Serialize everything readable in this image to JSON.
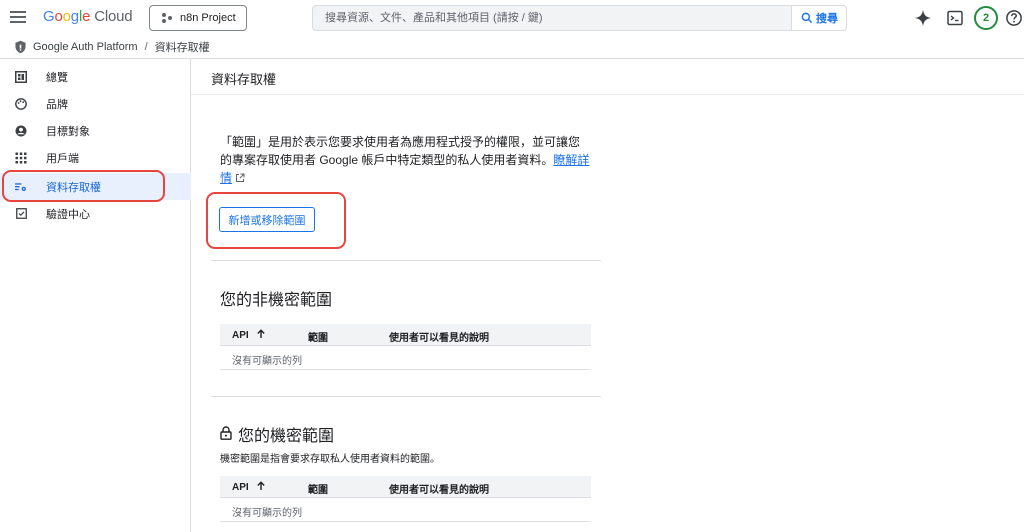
{
  "topbar": {
    "logo_word": "Google",
    "logo_product": "Cloud",
    "project_name": "n8n Project",
    "search_placeholder": "搜尋資源、文件、產品和其他項目 (請按 / 鍵)",
    "search_button": "搜尋",
    "avatar_count": "2"
  },
  "breadcrumb": {
    "root": "Google Auth Platform",
    "separator": "/",
    "current": "資料存取權"
  },
  "sidebar": {
    "items": [
      {
        "label": "總覽",
        "icon": "dashboard-icon"
      },
      {
        "label": "品牌",
        "icon": "palette-icon"
      },
      {
        "label": "目標對象",
        "icon": "account-circle-icon"
      },
      {
        "label": "用戶端",
        "icon": "apps-grid-icon"
      },
      {
        "label": "資料存取權",
        "icon": "data-access-icon",
        "active": true
      },
      {
        "label": "驗證中心",
        "icon": "checkbox-icon"
      }
    ]
  },
  "main": {
    "title": "資料存取權",
    "description": "「範圍」是用於表示您要求使用者為應用程式授予的權限，並可讓您的專案存取使用者 Google 帳戶中特定類型的私人使用者資料。",
    "learn_more": "瞭解詳情",
    "add_button": "新增或移除範圍",
    "non_sensitive": {
      "title": "您的非機密範圍",
      "columns": [
        "API",
        "範圍",
        "使用者可以看見的說明"
      ],
      "empty": "沒有可顯示的列"
    },
    "sensitive": {
      "title": "您的機密範圍",
      "description": "機密範圍是指會要求存取私人使用者資料的範圍。",
      "columns": [
        "API",
        "範圍",
        "使用者可以看見的說明"
      ],
      "empty": "沒有可顯示的列"
    }
  },
  "colors": {
    "accent": "#1a73e8",
    "highlight": "#e8453c",
    "active_bg": "#e8f0fe",
    "avatar": "#1e8e3e"
  }
}
